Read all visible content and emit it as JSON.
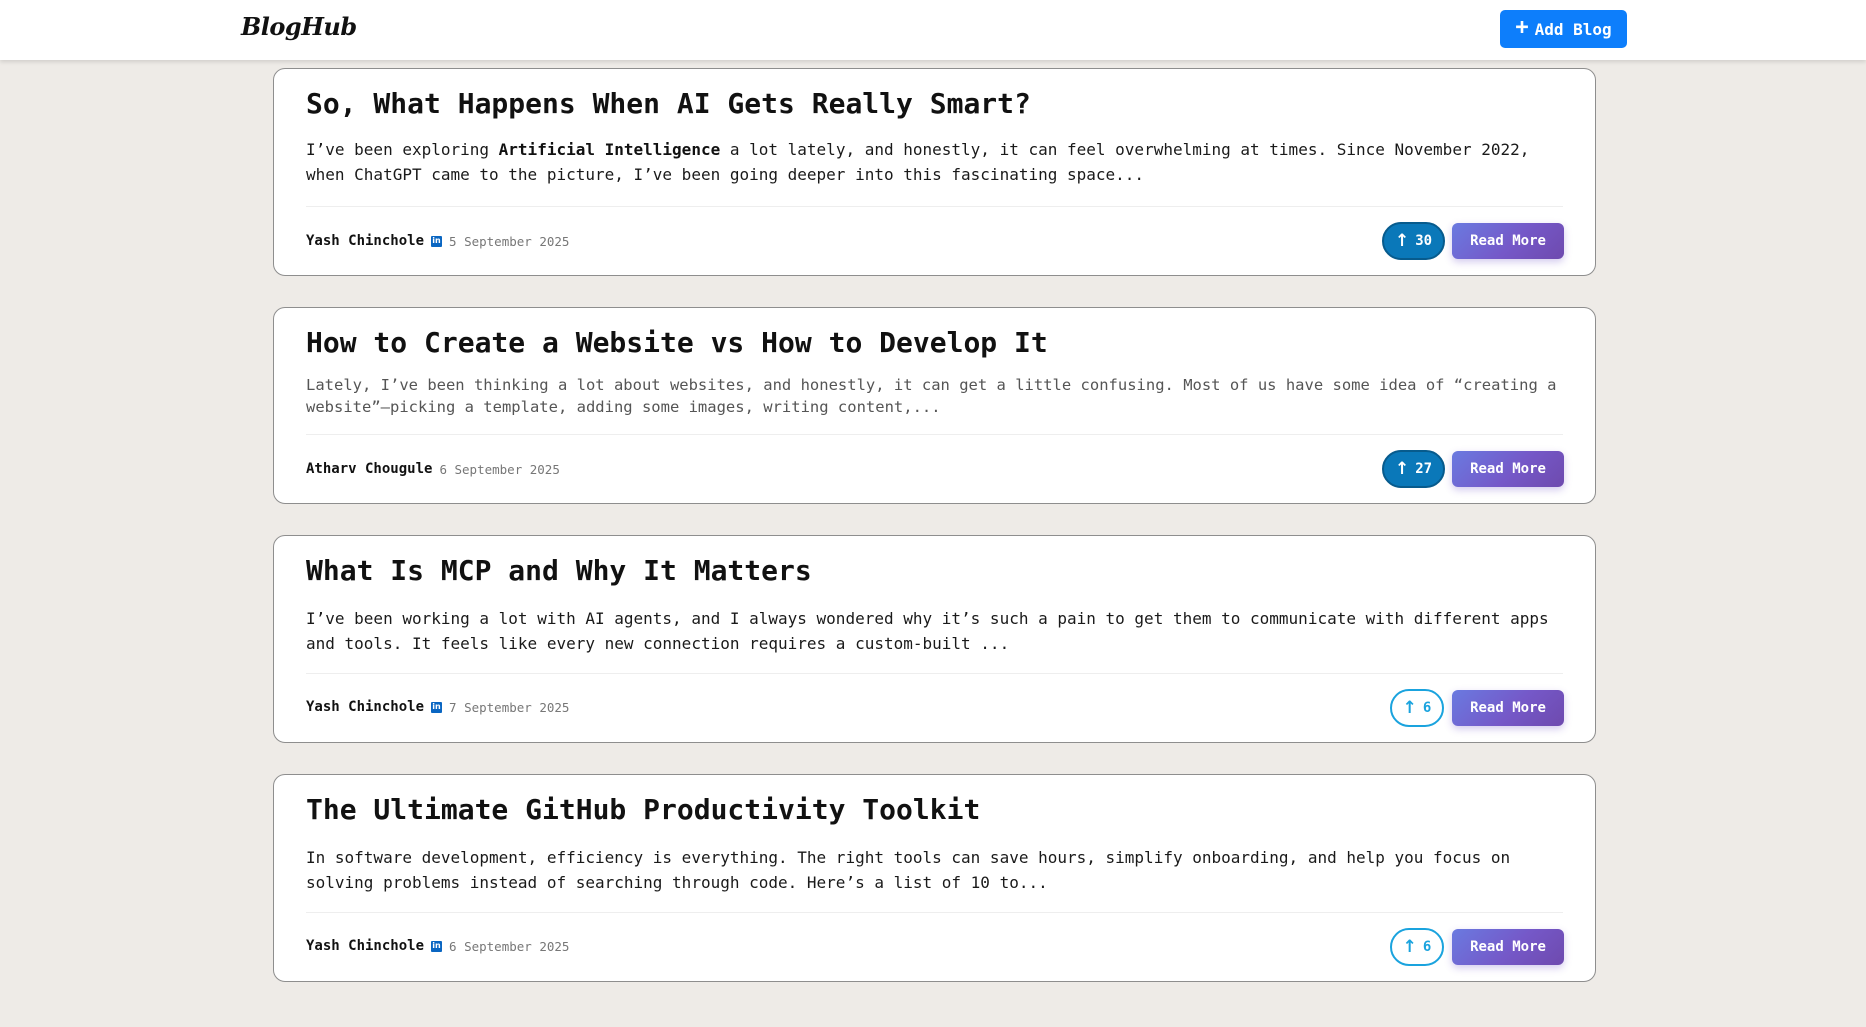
{
  "navbar": {
    "brand": "BlogHub",
    "add_blog_icon": "plus-icon",
    "add_blog_label": "Add Blog"
  },
  "colors": {
    "primary_button": "#0d7efb",
    "upvote_filled": "#0a78b9",
    "upvote_outline": "#1aa3de",
    "read_more_gradient_start": "#6a7ae0",
    "read_more_gradient_end": "#6e4aae",
    "linkedin": "#0a66c2",
    "page_background": "#eeebe7"
  },
  "posts": [
    {
      "title": "So, What Happens When AI Gets Really Smart?",
      "excerpt_before": "I’ve been exploring ",
      "excerpt_bold": "Artificial Intelligence",
      "excerpt_after": " a lot lately, and honestly, it can feel overwhelming at times. Since November 2022, when ChatGPT came to the picture, I’ve been going deeper into this fascinating space...",
      "author": "Yash Chinchole",
      "linkedin_icon": "linkedin-icon",
      "date": "5 September 2025",
      "upvotes": "30",
      "upvoted": true,
      "read_more": "Read More"
    },
    {
      "title": "How to Create a Website vs How to Develop It",
      "excerpt": "Lately, I’ve been thinking a lot about websites, and honestly, it can get a little confusing. Most of us have some idea of “creating a website”—picking a template, adding some images, writing content,...",
      "author": "Atharv Chougule",
      "date": "6 September 2025",
      "upvotes": "27",
      "upvoted": true,
      "read_more": "Read More"
    },
    {
      "title": "What Is MCP and Why It Matters",
      "excerpt": "I’ve been working a lot with AI agents, and I always wondered why it’s such a pain to get them to communicate with different apps and tools. It feels like every new connection requires a custom-built ...",
      "author": "Yash Chinchole",
      "linkedin_icon": "linkedin-icon",
      "date": "7 September 2025",
      "upvotes": "6",
      "upvoted": false,
      "read_more": "Read More"
    },
    {
      "title": "The Ultimate GitHub Productivity Toolkit",
      "excerpt": "In software development, efficiency is everything. The right tools can save hours, simplify onboarding, and help you focus on solving problems instead of searching through code. Here’s a list of 10 to...",
      "author": "Yash Chinchole",
      "linkedin_icon": "linkedin-icon",
      "date": "6 September 2025",
      "upvotes": "6",
      "upvoted": false,
      "read_more": "Read More"
    }
  ],
  "upvote_icon": "arrow-up-icon"
}
